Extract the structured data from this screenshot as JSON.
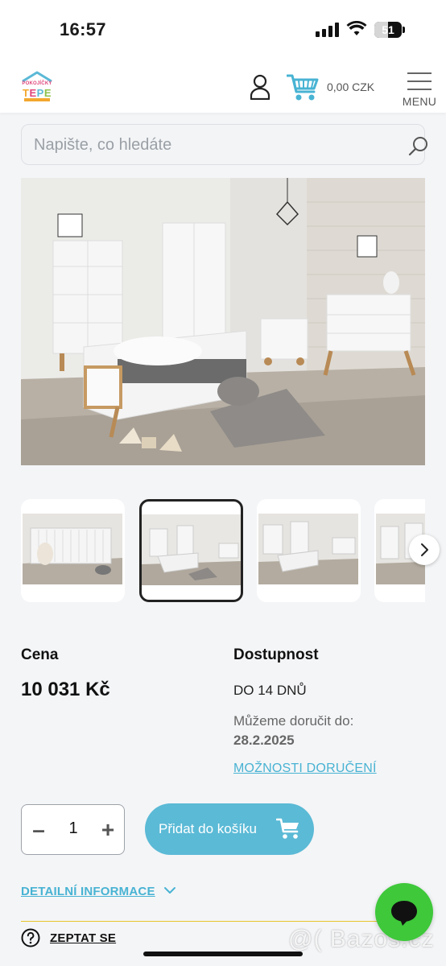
{
  "status_bar": {
    "time": "16:57",
    "battery": "51"
  },
  "header": {
    "logo_top": "POKOJÍČKY",
    "logo_main": [
      "T",
      "E",
      "P",
      "E"
    ],
    "cart_total": "0,00 CZK",
    "menu_label": "MENU"
  },
  "search": {
    "placeholder": "Napište, co hledáte"
  },
  "product": {
    "price_label": "Cena",
    "price": "10 031 Kč",
    "availability_label": "Dostupnost",
    "availability": "DO 14 DNŮ",
    "deliver_label": "Můžeme doručit do:",
    "deliver_date": "28.2.2025",
    "delivery_options": "MOŽNOSTI DORUČENÍ",
    "quantity": "1",
    "add_to_cart": "Přidat do košíku",
    "detail_info": "DETAILNÍ INFORMACE",
    "ask": "ZEPTAT SE"
  },
  "gallery": {
    "thumbnail_count": 4,
    "active_thumbnail": 2
  },
  "watermark": "@( Bazos.cz",
  "colors": {
    "accent": "#5bbad6",
    "link": "#48b3d3",
    "chat": "#3ec83a",
    "divider": "#e8c52a"
  }
}
